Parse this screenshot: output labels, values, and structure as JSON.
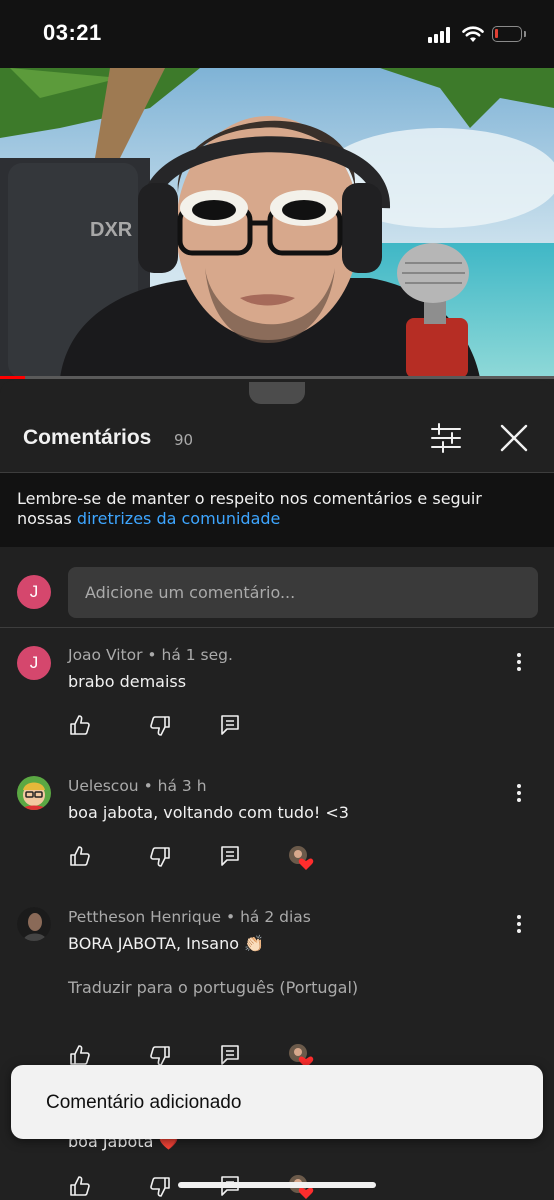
{
  "status_bar": {
    "time": "03:21",
    "battery_level_fraction": 0.1
  },
  "video": {
    "progress_fraction": 0.045,
    "chair_brand": "DXR"
  },
  "comments_sheet": {
    "title": "Comentários",
    "count": "90",
    "notice_text": "Lembre-se de manter o respeito nos comentários e seguir nossas ",
    "notice_link": "diretrizes da comunidade",
    "user_avatar_letter": "J",
    "add_placeholder": "Adicione um comentário..."
  },
  "comments": [
    {
      "author": "Joao Vitor",
      "time": "há 1 seg.",
      "text": "brabo demaiss",
      "avatar_letter": "J"
    },
    {
      "author": "Uelescou",
      "time": "há 3 h",
      "text": "boa jabota, voltando com tudo! <3"
    },
    {
      "author": "Pettheson Henrique",
      "time": "há 2 dias",
      "text": "BORA JABOTA, Insano 👏🏻",
      "translate": "Traduzir para o português (Portugal)"
    },
    {
      "text": "boa Jabota ❤️"
    }
  ],
  "separator": "•",
  "toast": {
    "text": "Comentário adicionado"
  },
  "colors": {
    "accent_link": "#3ea6ff",
    "brand_red": "#ff0000",
    "avatar_j": "#d5476d",
    "heart": "#ff2d2d"
  }
}
